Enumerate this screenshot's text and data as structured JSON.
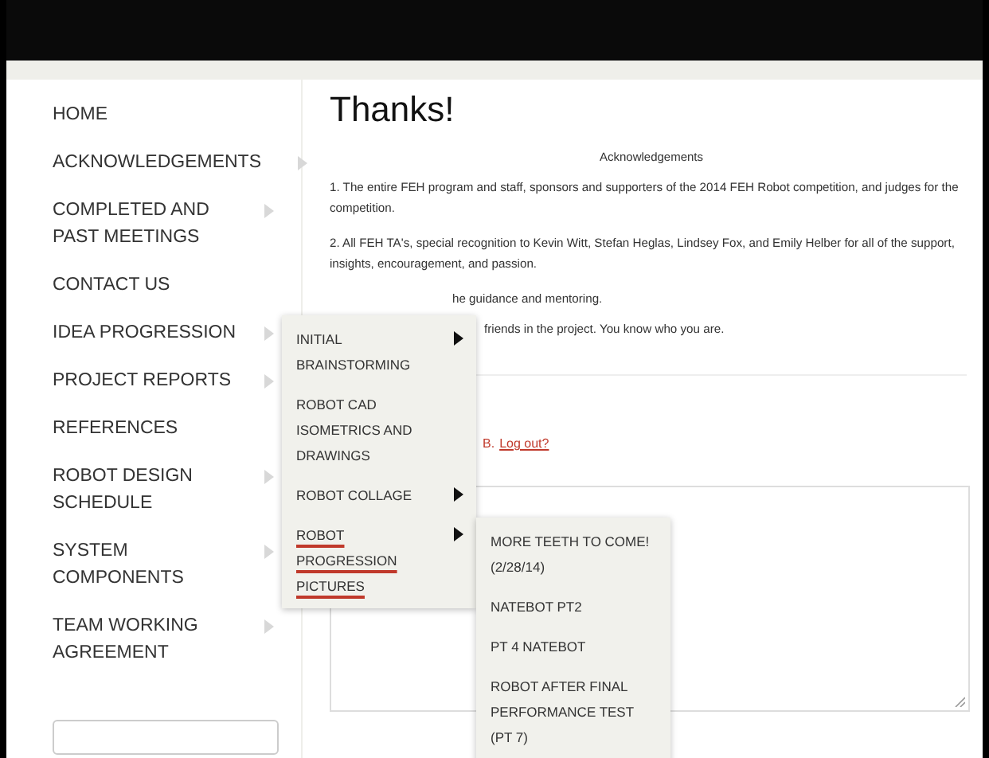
{
  "sidebar": {
    "items": [
      {
        "label": "HOME",
        "has_submenu": false
      },
      {
        "label": "ACKNOWLEDGEMENTS",
        "has_submenu": true
      },
      {
        "label": "COMPLETED AND PAST MEETINGS",
        "has_submenu": true
      },
      {
        "label": "CONTACT US",
        "has_submenu": false
      },
      {
        "label": "IDEA PROGRESSION",
        "has_submenu": true
      },
      {
        "label": "PROJECT REPORTS",
        "has_submenu": true
      },
      {
        "label": "REFERENCES",
        "has_submenu": false
      },
      {
        "label": "ROBOT DESIGN SCHEDULE",
        "has_submenu": true
      },
      {
        "label": "SYSTEM COMPONENTS",
        "has_submenu": true
      },
      {
        "label": "TEAM WORKING AGREEMENT",
        "has_submenu": true
      }
    ]
  },
  "content": {
    "title": "Thanks!",
    "heading": "Acknowledgements",
    "paragraphs": [
      "1. The entire FEH program and staff, sponsors and supporters of the 2014 FEH Robot competition, and judges for the competition.",
      "2. All FEH TA's, special recognition to Kevin Witt, Stefan Heglas, Lindsey Fox, and Emily Helber for all of the support, insights, encouragement, and passion."
    ],
    "partial_lines": [
      "he guidance and mentoring.",
      "friends in the project. You know who you are."
    ],
    "login_prefix": "B.",
    "logout_link": "Log out?"
  },
  "submenu": {
    "items": [
      {
        "label": "INITIAL BRAINSTORMING",
        "has_submenu": true,
        "selected": false
      },
      {
        "label": "ROBOT CAD ISOMETRICS AND DRAWINGS",
        "has_submenu": false,
        "selected": false
      },
      {
        "label": "ROBOT COLLAGE",
        "has_submenu": true,
        "selected": false
      },
      {
        "label": "ROBOT PROGRESSION PICTURES",
        "has_submenu": true,
        "selected": true
      }
    ]
  },
  "sub_submenu": {
    "items": [
      {
        "label": "MORE TEETH TO COME! (2/28/14)"
      },
      {
        "label": "NATEBOT PT2"
      },
      {
        "label": "PT 4 NATEBOT"
      },
      {
        "label": "ROBOT AFTER FINAL PERFORMANCE TEST (PT 7)"
      }
    ]
  }
}
